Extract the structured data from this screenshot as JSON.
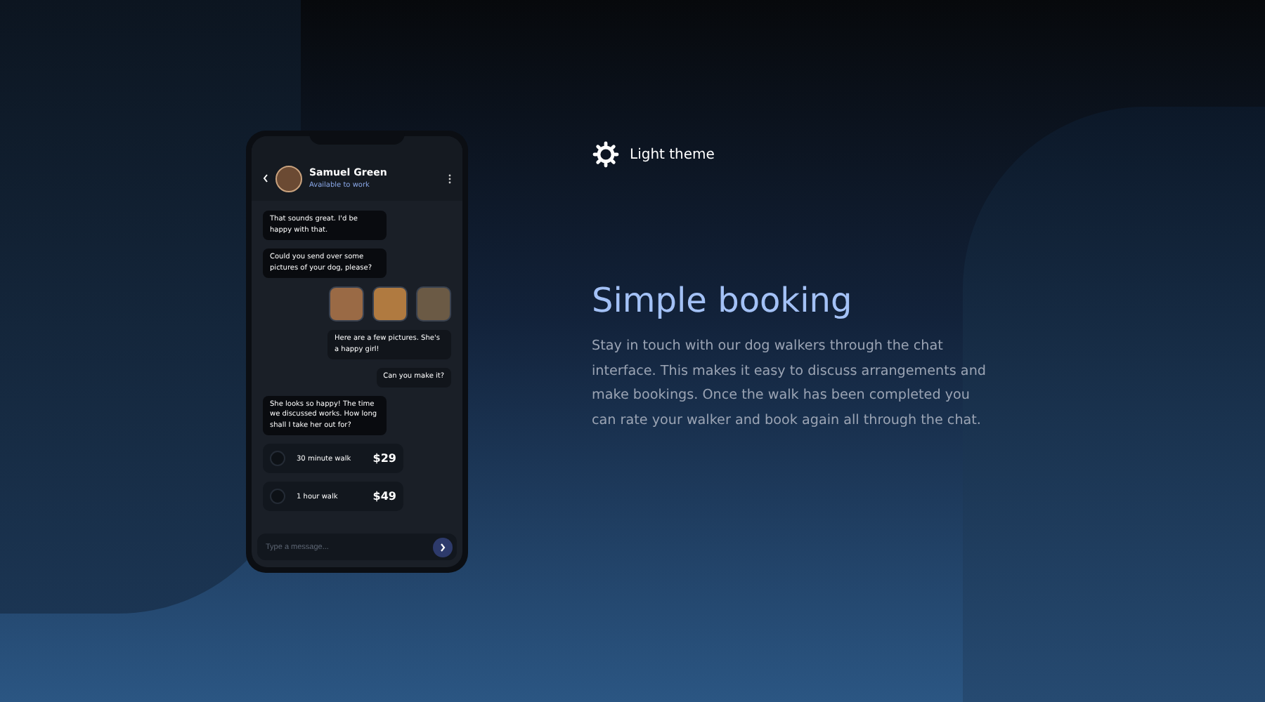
{
  "theme_toggle": {
    "label": "Light theme"
  },
  "chat": {
    "contact": {
      "name": "Samuel Green",
      "status": "Available to work"
    },
    "messages": [
      {
        "kind": "text",
        "outgoing": false,
        "text": "That sounds great. I'd be happy with that."
      },
      {
        "kind": "text",
        "outgoing": false,
        "text": "Could you send over some pictures of your dog, please?"
      },
      {
        "kind": "photos",
        "outgoing": true,
        "photos": [
          {
            "kind": "photo"
          },
          {
            "kind": "photo"
          },
          {
            "kind": "photo"
          }
        ]
      },
      {
        "kind": "text",
        "outgoing": true,
        "text": "Here are a few pictures. She's a happy girl!"
      },
      {
        "kind": "text",
        "outgoing": true,
        "text": "Can you make it?"
      },
      {
        "kind": "text",
        "outgoing": false,
        "text": "She looks so happy! The time we discussed works. How long shall I take her out for?"
      },
      {
        "kind": "option",
        "label": "30 minute walk",
        "price": "$29",
        "selected": false
      },
      {
        "kind": "option",
        "label": "1 hour walk",
        "price": "$49",
        "selected": false
      }
    ],
    "input": {
      "placeholder": "Type a message..."
    }
  },
  "feature": {
    "title": "Simple booking",
    "text": "Stay in touch with our dog walkers through the chat interface. This makes it easy to discuss arrangements and make bookings. Once the walk has been completed you can rate your walker and book again all through the chat."
  }
}
